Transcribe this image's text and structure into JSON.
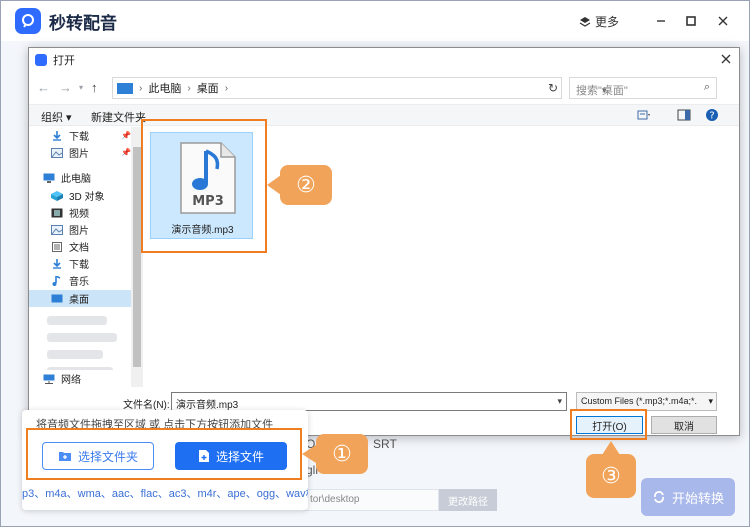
{
  "app": {
    "title": "秒转配音",
    "more_label": "更多",
    "start_button": "开始转换",
    "path_value": "tor\\desktop",
    "path_button": "更改路径",
    "bg_formats": "OR",
    "bg_srt": "SRT",
    "bg_lang": "gli"
  },
  "dialog": {
    "title": "打开",
    "breadcrumb": [
      "此电脑",
      "桌面"
    ],
    "search_placeholder": "搜索\"桌面\"",
    "toolbar": {
      "organize": "组织 ▾",
      "new_folder": "新建文件夹"
    },
    "nav_items": [
      {
        "label": "下载",
        "icon": "download-icon",
        "pinned": true
      },
      {
        "label": "图片",
        "icon": "pictures-icon",
        "pinned": true
      },
      {
        "label": "此电脑",
        "icon": "computer-icon"
      },
      {
        "label": "3D 对象",
        "icon": "3d-objects-icon"
      },
      {
        "label": "视频",
        "icon": "video-icon"
      },
      {
        "label": "图片",
        "icon": "pictures-icon"
      },
      {
        "label": "文档",
        "icon": "document-icon"
      },
      {
        "label": "下载",
        "icon": "download-icon"
      },
      {
        "label": "音乐",
        "icon": "music-icon"
      },
      {
        "label": "桌面",
        "icon": "desktop-icon",
        "selected": true
      },
      {
        "label": "网络",
        "icon": "network-icon"
      }
    ],
    "file": {
      "name": "演示音频.mp3",
      "badge": "MP3"
    },
    "filename_label": "文件名(N):",
    "filename_value": "演示音频.mp3",
    "filter_value": "Custom Files (*.mp3;*.m4a;*.",
    "open_button": "打开(O)",
    "cancel_button": "取消"
  },
  "upload": {
    "hint": "将音频文件拖拽至区域 或 点击下方按钮添加文件",
    "folder_button": "选择文件夹",
    "file_button": "选择文件",
    "formats": "p3、m4a、wma、aac、flac、ac3、m4r、ape、ogg、wav格"
  },
  "steps": [
    "①",
    "②",
    "③"
  ],
  "colors": {
    "accent": "#ef7d22",
    "primary": "#1f6ff2",
    "bubble": "#f2a35a"
  }
}
